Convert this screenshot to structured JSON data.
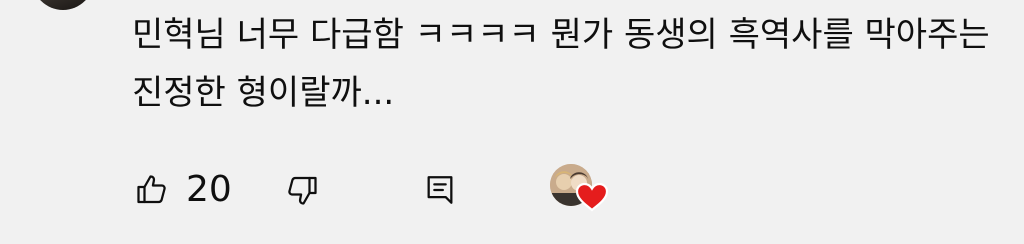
{
  "comment": {
    "text": "민혁님 너무 다급함 ㅋㅋㅋㅋ 뭔가 동생의 흑역사를 막아주는 진정한 형이랄까..."
  },
  "actions": {
    "like_count": "20"
  },
  "icons": {
    "like": "thumbs-up-icon",
    "dislike": "thumbs-down-icon",
    "reply": "reply-icon",
    "heart": "heart-icon"
  },
  "colors": {
    "background": "#f1f1f1",
    "text": "#0f0f0f",
    "heart": "#e51d1d"
  }
}
